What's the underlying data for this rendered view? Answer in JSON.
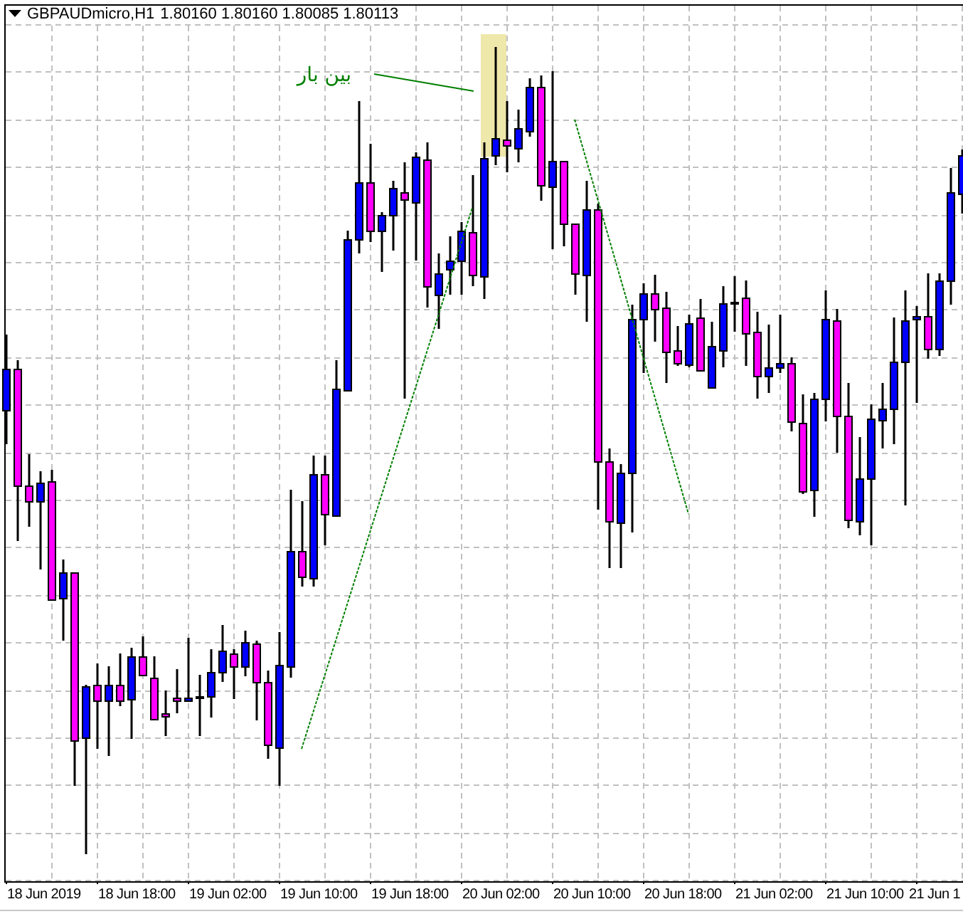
{
  "chart": {
    "symbol": "GBPAUDmicro,H1",
    "quote": "1.80160 1.80160 1.80085 1.80113",
    "annotation": "بین بار",
    "time_axis": [
      "18 Jun 2019",
      "18 Jun 18:00",
      "19 Jun 02:00",
      "19 Jun 10:00",
      "19 Jun 18:00",
      "20 Jun 02:00",
      "20 Jun 10:00",
      "20 Jun 18:00",
      "21 Jun 02:00",
      "21 Jun 10:00",
      "21 Jun 1"
    ]
  }
}
